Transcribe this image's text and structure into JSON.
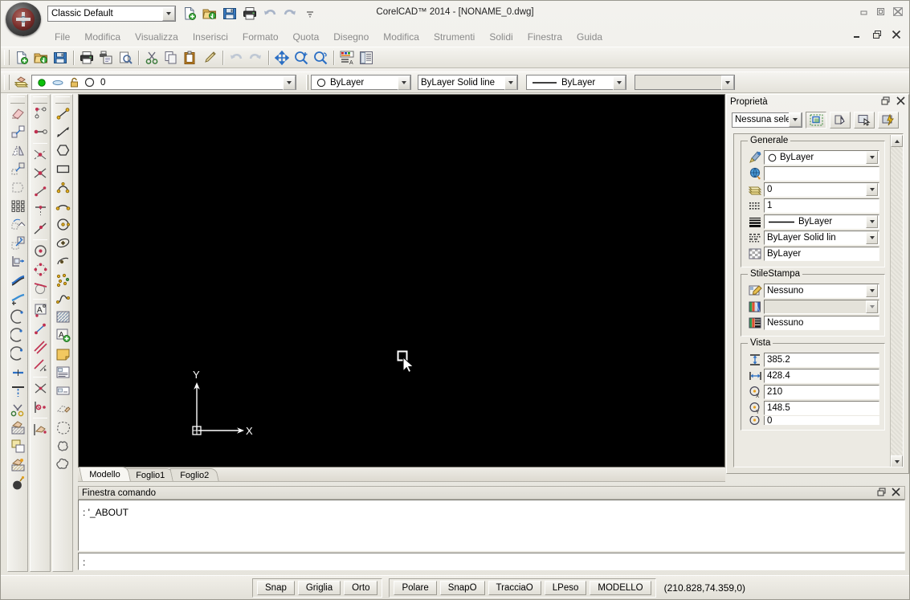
{
  "window": {
    "title": "CorelCAD™ 2014 - [NONAME_0.dwg]",
    "workspace": "Classic Default",
    "min": "—",
    "max": "❐",
    "close": "✖",
    "doc_min": "_",
    "doc_max": "❐",
    "doc_close": "✕"
  },
  "menu": {
    "items": [
      "File",
      "Modifica",
      "Visualizza",
      "Inserisci",
      "Formato",
      "Quota",
      "Disegno",
      "Modifica",
      "Strumenti",
      "Solidi",
      "Finestra",
      "Guida"
    ]
  },
  "quick_access": [
    {
      "name": "new-icon"
    },
    {
      "name": "open-icon"
    },
    {
      "name": "save-icon"
    },
    {
      "name": "print-icon"
    },
    {
      "name": "undo-icon"
    },
    {
      "name": "redo-icon"
    },
    {
      "name": "more-icon"
    }
  ],
  "toolbar_standard": [
    {
      "name": "new-icon"
    },
    {
      "name": "open-icon"
    },
    {
      "name": "save-icon"
    },
    {
      "name": "print-icon"
    },
    {
      "name": "print-preview-icon"
    },
    {
      "name": "print-setup-icon"
    },
    {
      "name": "cut-icon"
    },
    {
      "name": "copy-icon"
    },
    {
      "name": "paste-icon"
    },
    {
      "name": "format-painter-icon"
    },
    {
      "name": "undo-icon"
    },
    {
      "name": "redo-icon"
    },
    {
      "name": "pan-icon"
    },
    {
      "name": "zoom-in-icon"
    },
    {
      "name": "zoom-previous-icon"
    },
    {
      "name": "properties-icon"
    },
    {
      "name": "design-resources-icon"
    }
  ],
  "toolbar_layers": {
    "layer_manager_icon": "layers-icon",
    "layer_value": "0",
    "on_icon": "lightbulb-on-icon",
    "freeze_icon": "freeze-icon",
    "lock_icon": "unlock-icon",
    "color_icon": "layer-color-icon"
  },
  "toolbar_properties": {
    "color": "ByLayer",
    "linestyle": "ByLayer    Solid line",
    "lineweight": "ByLayer",
    "printstyle": ""
  },
  "drawing": {
    "ucs_x_label": "X",
    "ucs_y_label": "Y",
    "tabs": [
      {
        "label": "Modello",
        "active": true
      },
      {
        "label": "Foglio1",
        "active": false
      },
      {
        "label": "Foglio2",
        "active": false
      }
    ]
  },
  "command_window": {
    "title": "Finestra comando",
    "history": ": '_ABOUT",
    "prompt": ":",
    "restore_icon": "restore-icon",
    "close_icon": "close-icon"
  },
  "status_bar": {
    "group1": [
      "Snap",
      "Griglia",
      "Orto"
    ],
    "group2": [
      "Polare",
      "SnapO",
      "TracciaO",
      "LPeso",
      "MODELLO"
    ],
    "coordinates": "(210.828,74.359,0)"
  },
  "properties_panel": {
    "title": "Proprietà",
    "restore_icon": "restore-icon",
    "close_icon": "close-icon",
    "selection": "Nessuna sele",
    "tool_buttons": [
      {
        "name": "quick-select-icon"
      },
      {
        "name": "select-entities-icon"
      },
      {
        "name": "pick-entity-icon"
      },
      {
        "name": "quick-properties-icon"
      }
    ],
    "sections": [
      {
        "title": "Generale",
        "rows": [
          {
            "icon": "color-icon",
            "value": "ByLayer",
            "dropdown": true,
            "swatch": "circle",
            "grey": false
          },
          {
            "icon": "globe-icon",
            "value": "",
            "dropdown": false,
            "grey": false
          },
          {
            "icon": "layer-icon",
            "value": "0",
            "dropdown": true,
            "grey": false
          },
          {
            "icon": "linetype-scale-icon",
            "value": "1",
            "dropdown": false,
            "grey": false
          },
          {
            "icon": "lineweight-icon",
            "value": "ByLayer",
            "dropdown": true,
            "line": true,
            "grey": false
          },
          {
            "icon": "linestyle-icon",
            "value": "ByLayer    Solid lin",
            "dropdown": true,
            "grey": false
          },
          {
            "icon": "transparency-icon",
            "value": "ByLayer",
            "dropdown": false,
            "grey": false
          }
        ]
      },
      {
        "title": "StileStampa",
        "rows": [
          {
            "icon": "printstyle-icon",
            "value": "Nessuno",
            "dropdown": true,
            "grey": false
          },
          {
            "icon": "printstyle-table-icon",
            "value": "",
            "dropdown": true,
            "grey": true
          },
          {
            "icon": "printstyle-attach-icon",
            "value": "Nessuno",
            "dropdown": false,
            "grey": false
          }
        ]
      },
      {
        "title": "Vista",
        "rows": [
          {
            "icon": "view-height-icon",
            "value": "385.2",
            "dropdown": false,
            "grey": false
          },
          {
            "icon": "view-width-icon",
            "value": "428.4",
            "dropdown": false,
            "grey": false
          },
          {
            "icon": "center-x-icon",
            "value": "210",
            "dropdown": false,
            "grey": false
          },
          {
            "icon": "center-y-icon",
            "value": "148.5",
            "dropdown": false,
            "grey": false
          },
          {
            "icon": "center-z-icon",
            "value": "0",
            "dropdown": false,
            "grey": false
          }
        ]
      }
    ]
  },
  "colors": {
    "canvas": "#000000",
    "chrome": "#e8e6de",
    "accent_green": "#00b000",
    "accent_blue": "#2b6fc4"
  }
}
